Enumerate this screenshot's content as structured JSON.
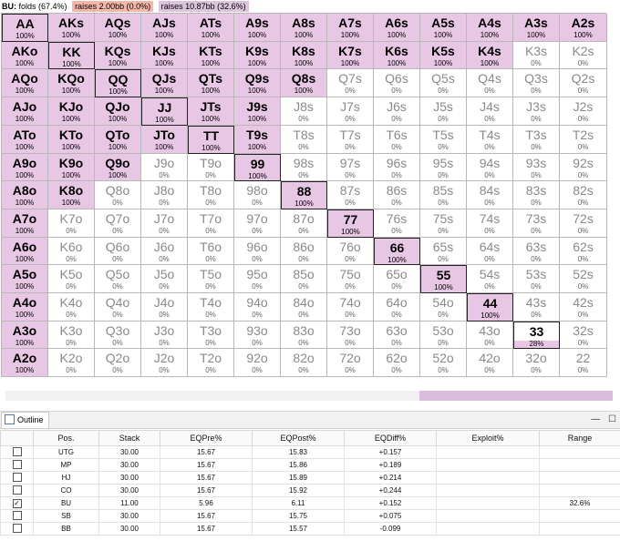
{
  "header": {
    "position": "BU:",
    "folds": "folds (67.4%)",
    "raise_small": "raises 2.00bb (0.0%)",
    "raise_big": "raises 10.87bb (32.6%)",
    "colors": {
      "raise_small": "#f4b7aa",
      "raise_big": "#dcc4dc",
      "range_fill": "#e8c7e5"
    }
  },
  "grid": [
    [
      {
        "h": "AA",
        "p": "100%"
      },
      {
        "h": "AKs",
        "p": "100%"
      },
      {
        "h": "AQs",
        "p": "100%"
      },
      {
        "h": "AJs",
        "p": "100%"
      },
      {
        "h": "ATs",
        "p": "100%"
      },
      {
        "h": "A9s",
        "p": "100%"
      },
      {
        "h": "A8s",
        "p": "100%"
      },
      {
        "h": "A7s",
        "p": "100%"
      },
      {
        "h": "A6s",
        "p": "100%"
      },
      {
        "h": "A5s",
        "p": "100%"
      },
      {
        "h": "A4s",
        "p": "100%"
      },
      {
        "h": "A3s",
        "p": "100%"
      },
      {
        "h": "A2s",
        "p": "100%"
      }
    ],
    [
      {
        "h": "AKo",
        "p": "100%"
      },
      {
        "h": "KK",
        "p": "100%"
      },
      {
        "h": "KQs",
        "p": "100%"
      },
      {
        "h": "KJs",
        "p": "100%"
      },
      {
        "h": "KTs",
        "p": "100%"
      },
      {
        "h": "K9s",
        "p": "100%"
      },
      {
        "h": "K8s",
        "p": "100%"
      },
      {
        "h": "K7s",
        "p": "100%"
      },
      {
        "h": "K6s",
        "p": "100%"
      },
      {
        "h": "K5s",
        "p": "100%"
      },
      {
        "h": "K4s",
        "p": "100%"
      },
      {
        "h": "K3s",
        "p": "0%"
      },
      {
        "h": "K2s",
        "p": "0%"
      }
    ],
    [
      {
        "h": "AQo",
        "p": "100%"
      },
      {
        "h": "KQo",
        "p": "100%"
      },
      {
        "h": "QQ",
        "p": "100%"
      },
      {
        "h": "QJs",
        "p": "100%"
      },
      {
        "h": "QTs",
        "p": "100%"
      },
      {
        "h": "Q9s",
        "p": "100%"
      },
      {
        "h": "Q8s",
        "p": "100%"
      },
      {
        "h": "Q7s",
        "p": "0%"
      },
      {
        "h": "Q6s",
        "p": "0%"
      },
      {
        "h": "Q5s",
        "p": "0%"
      },
      {
        "h": "Q4s",
        "p": "0%"
      },
      {
        "h": "Q3s",
        "p": "0%"
      },
      {
        "h": "Q2s",
        "p": "0%"
      }
    ],
    [
      {
        "h": "AJo",
        "p": "100%"
      },
      {
        "h": "KJo",
        "p": "100%"
      },
      {
        "h": "QJo",
        "p": "100%"
      },
      {
        "h": "JJ",
        "p": "100%"
      },
      {
        "h": "JTs",
        "p": "100%"
      },
      {
        "h": "J9s",
        "p": "100%"
      },
      {
        "h": "J8s",
        "p": "0%"
      },
      {
        "h": "J7s",
        "p": "0%"
      },
      {
        "h": "J6s",
        "p": "0%"
      },
      {
        "h": "J5s",
        "p": "0%"
      },
      {
        "h": "J4s",
        "p": "0%"
      },
      {
        "h": "J3s",
        "p": "0%"
      },
      {
        "h": "J2s",
        "p": "0%"
      }
    ],
    [
      {
        "h": "ATo",
        "p": "100%"
      },
      {
        "h": "KTo",
        "p": "100%"
      },
      {
        "h": "QTo",
        "p": "100%"
      },
      {
        "h": "JTo",
        "p": "100%"
      },
      {
        "h": "TT",
        "p": "100%"
      },
      {
        "h": "T9s",
        "p": "100%"
      },
      {
        "h": "T8s",
        "p": "0%"
      },
      {
        "h": "T7s",
        "p": "0%"
      },
      {
        "h": "T6s",
        "p": "0%"
      },
      {
        "h": "T5s",
        "p": "0%"
      },
      {
        "h": "T4s",
        "p": "0%"
      },
      {
        "h": "T3s",
        "p": "0%"
      },
      {
        "h": "T2s",
        "p": "0%"
      }
    ],
    [
      {
        "h": "A9o",
        "p": "100%"
      },
      {
        "h": "K9o",
        "p": "100%"
      },
      {
        "h": "Q9o",
        "p": "100%"
      },
      {
        "h": "J9o",
        "p": "0%"
      },
      {
        "h": "T9o",
        "p": "0%"
      },
      {
        "h": "99",
        "p": "100%"
      },
      {
        "h": "98s",
        "p": "0%"
      },
      {
        "h": "97s",
        "p": "0%"
      },
      {
        "h": "96s",
        "p": "0%"
      },
      {
        "h": "95s",
        "p": "0%"
      },
      {
        "h": "94s",
        "p": "0%"
      },
      {
        "h": "93s",
        "p": "0%"
      },
      {
        "h": "92s",
        "p": "0%"
      }
    ],
    [
      {
        "h": "A8o",
        "p": "100%"
      },
      {
        "h": "K8o",
        "p": "100%"
      },
      {
        "h": "Q8o",
        "p": "0%"
      },
      {
        "h": "J8o",
        "p": "0%"
      },
      {
        "h": "T8o",
        "p": "0%"
      },
      {
        "h": "98o",
        "p": "0%"
      },
      {
        "h": "88",
        "p": "100%"
      },
      {
        "h": "87s",
        "p": "0%"
      },
      {
        "h": "86s",
        "p": "0%"
      },
      {
        "h": "85s",
        "p": "0%"
      },
      {
        "h": "84s",
        "p": "0%"
      },
      {
        "h": "83s",
        "p": "0%"
      },
      {
        "h": "82s",
        "p": "0%"
      }
    ],
    [
      {
        "h": "A7o",
        "p": "100%"
      },
      {
        "h": "K7o",
        "p": "0%"
      },
      {
        "h": "Q7o",
        "p": "0%"
      },
      {
        "h": "J7o",
        "p": "0%"
      },
      {
        "h": "T7o",
        "p": "0%"
      },
      {
        "h": "97o",
        "p": "0%"
      },
      {
        "h": "87o",
        "p": "0%"
      },
      {
        "h": "77",
        "p": "100%"
      },
      {
        "h": "76s",
        "p": "0%"
      },
      {
        "h": "75s",
        "p": "0%"
      },
      {
        "h": "74s",
        "p": "0%"
      },
      {
        "h": "73s",
        "p": "0%"
      },
      {
        "h": "72s",
        "p": "0%"
      }
    ],
    [
      {
        "h": "A6o",
        "p": "100%"
      },
      {
        "h": "K6o",
        "p": "0%"
      },
      {
        "h": "Q6o",
        "p": "0%"
      },
      {
        "h": "J6o",
        "p": "0%"
      },
      {
        "h": "T6o",
        "p": "0%"
      },
      {
        "h": "96o",
        "p": "0%"
      },
      {
        "h": "86o",
        "p": "0%"
      },
      {
        "h": "76o",
        "p": "0%"
      },
      {
        "h": "66",
        "p": "100%"
      },
      {
        "h": "65s",
        "p": "0%"
      },
      {
        "h": "64s",
        "p": "0%"
      },
      {
        "h": "63s",
        "p": "0%"
      },
      {
        "h": "62s",
        "p": "0%"
      }
    ],
    [
      {
        "h": "A5o",
        "p": "100%"
      },
      {
        "h": "K5o",
        "p": "0%"
      },
      {
        "h": "Q5o",
        "p": "0%"
      },
      {
        "h": "J5o",
        "p": "0%"
      },
      {
        "h": "T5o",
        "p": "0%"
      },
      {
        "h": "95o",
        "p": "0%"
      },
      {
        "h": "85o",
        "p": "0%"
      },
      {
        "h": "75o",
        "p": "0%"
      },
      {
        "h": "65o",
        "p": "0%"
      },
      {
        "h": "55",
        "p": "100%"
      },
      {
        "h": "54s",
        "p": "0%"
      },
      {
        "h": "53s",
        "p": "0%"
      },
      {
        "h": "52s",
        "p": "0%"
      }
    ],
    [
      {
        "h": "A4o",
        "p": "100%"
      },
      {
        "h": "K4o",
        "p": "0%"
      },
      {
        "h": "Q4o",
        "p": "0%"
      },
      {
        "h": "J4o",
        "p": "0%"
      },
      {
        "h": "T4o",
        "p": "0%"
      },
      {
        "h": "94o",
        "p": "0%"
      },
      {
        "h": "84o",
        "p": "0%"
      },
      {
        "h": "74o",
        "p": "0%"
      },
      {
        "h": "64o",
        "p": "0%"
      },
      {
        "h": "54o",
        "p": "0%"
      },
      {
        "h": "44",
        "p": "100%"
      },
      {
        "h": "43s",
        "p": "0%"
      },
      {
        "h": "42s",
        "p": "0%"
      }
    ],
    [
      {
        "h": "A3o",
        "p": "100%"
      },
      {
        "h": "K3o",
        "p": "0%"
      },
      {
        "h": "Q3o",
        "p": "0%"
      },
      {
        "h": "J3o",
        "p": "0%"
      },
      {
        "h": "T3o",
        "p": "0%"
      },
      {
        "h": "93o",
        "p": "0%"
      },
      {
        "h": "83o",
        "p": "0%"
      },
      {
        "h": "73o",
        "p": "0%"
      },
      {
        "h": "63o",
        "p": "0%"
      },
      {
        "h": "53o",
        "p": "0%"
      },
      {
        "h": "43o",
        "p": "0%"
      },
      {
        "h": "33",
        "p": "28%"
      },
      {
        "h": "32s",
        "p": "0%"
      }
    ],
    [
      {
        "h": "A2o",
        "p": "100%"
      },
      {
        "h": "K2o",
        "p": "0%"
      },
      {
        "h": "Q2o",
        "p": "0%"
      },
      {
        "h": "J2o",
        "p": "0%"
      },
      {
        "h": "T2o",
        "p": "0%"
      },
      {
        "h": "92o",
        "p": "0%"
      },
      {
        "h": "82o",
        "p": "0%"
      },
      {
        "h": "72o",
        "p": "0%"
      },
      {
        "h": "62o",
        "p": "0%"
      },
      {
        "h": "52o",
        "p": "0%"
      },
      {
        "h": "42o",
        "p": "0%"
      },
      {
        "h": "32o",
        "p": "0%"
      },
      {
        "h": "22",
        "p": "0%"
      }
    ]
  ],
  "outline": {
    "tab_label": "Outline",
    "minimize": "—",
    "maximize": "☐",
    "columns": [
      "",
      "Pos.",
      "Stack",
      "EQPre%",
      "EQPost%",
      "EQDiff%",
      "Exploit%",
      "Range"
    ],
    "rows": [
      {
        "checked": false,
        "pos": "UTG",
        "stack": "30.00",
        "eqpre": "15.67",
        "eqpost": "15.83",
        "eqdiff": "+0.157",
        "exploit": "",
        "range": ""
      },
      {
        "checked": false,
        "pos": "MP",
        "stack": "30.00",
        "eqpre": "15.67",
        "eqpost": "15.86",
        "eqdiff": "+0.189",
        "exploit": "",
        "range": ""
      },
      {
        "checked": false,
        "pos": "HJ",
        "stack": "30.00",
        "eqpre": "15.67",
        "eqpost": "15.89",
        "eqdiff": "+0.214",
        "exploit": "",
        "range": ""
      },
      {
        "checked": false,
        "pos": "CO",
        "stack": "30.00",
        "eqpre": "15.67",
        "eqpost": "15.92",
        "eqdiff": "+0.244",
        "exploit": "",
        "range": ""
      },
      {
        "checked": true,
        "pos": "BU",
        "stack": "11.00",
        "eqpre": "5.96",
        "eqpost": "6.11",
        "eqdiff": "+0.152",
        "exploit": "",
        "range": "32.6%"
      },
      {
        "checked": false,
        "pos": "SB",
        "stack": "30.00",
        "eqpre": "15.67",
        "eqpost": "15.75",
        "eqdiff": "+0.075",
        "exploit": "",
        "range": ""
      },
      {
        "checked": false,
        "pos": "BB",
        "stack": "30.00",
        "eqpre": "15.67",
        "eqpost": "15.57",
        "eqdiff": "-0.099",
        "exploit": "",
        "range": ""
      }
    ]
  }
}
